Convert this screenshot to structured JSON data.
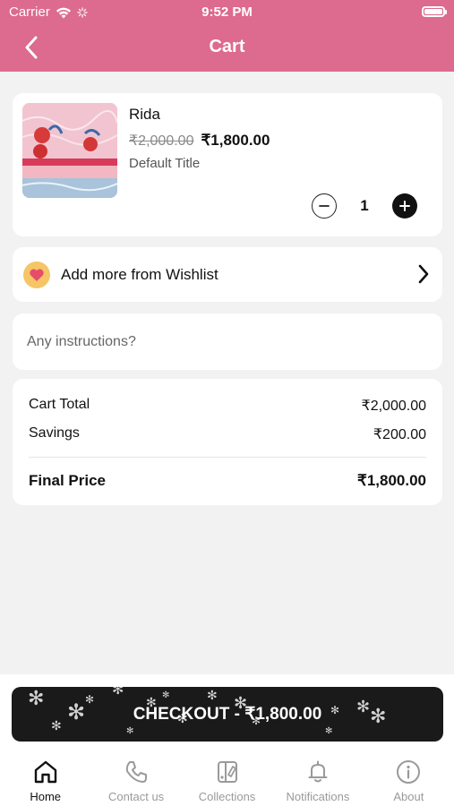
{
  "status_bar": {
    "carrier": "Carrier",
    "time": "9:52 PM"
  },
  "header": {
    "title": "Cart"
  },
  "cart_item": {
    "name": "Rida",
    "original_price": "₹2,000.00",
    "price": "₹1,800.00",
    "variant": "Default Title",
    "quantity": "1"
  },
  "wishlist": {
    "label": "Add more from Wishlist"
  },
  "instructions": {
    "placeholder": "Any instructions?"
  },
  "summary": {
    "cart_total_label": "Cart Total",
    "cart_total_value": "₹2,000.00",
    "savings_label": "Savings",
    "savings_value": "₹200.00",
    "final_label": "Final Price",
    "final_value": "₹1,800.00"
  },
  "checkout": {
    "label": "CHECKOUT - ₹1,800.00"
  },
  "tabbar": {
    "items": [
      {
        "label": "Home",
        "icon": "home-icon",
        "active": true
      },
      {
        "label": "Contact us",
        "icon": "phone-icon",
        "active": false
      },
      {
        "label": "Collections",
        "icon": "collections-icon",
        "active": false
      },
      {
        "label": "Notifications",
        "icon": "bell-icon",
        "active": false
      },
      {
        "label": "About",
        "icon": "info-icon",
        "active": false
      }
    ]
  },
  "colors": {
    "header": "#dd6a8f",
    "checkout": "#1a1a1a",
    "wishlist_badge": "#f5c566",
    "heart": "#e64d6a"
  }
}
